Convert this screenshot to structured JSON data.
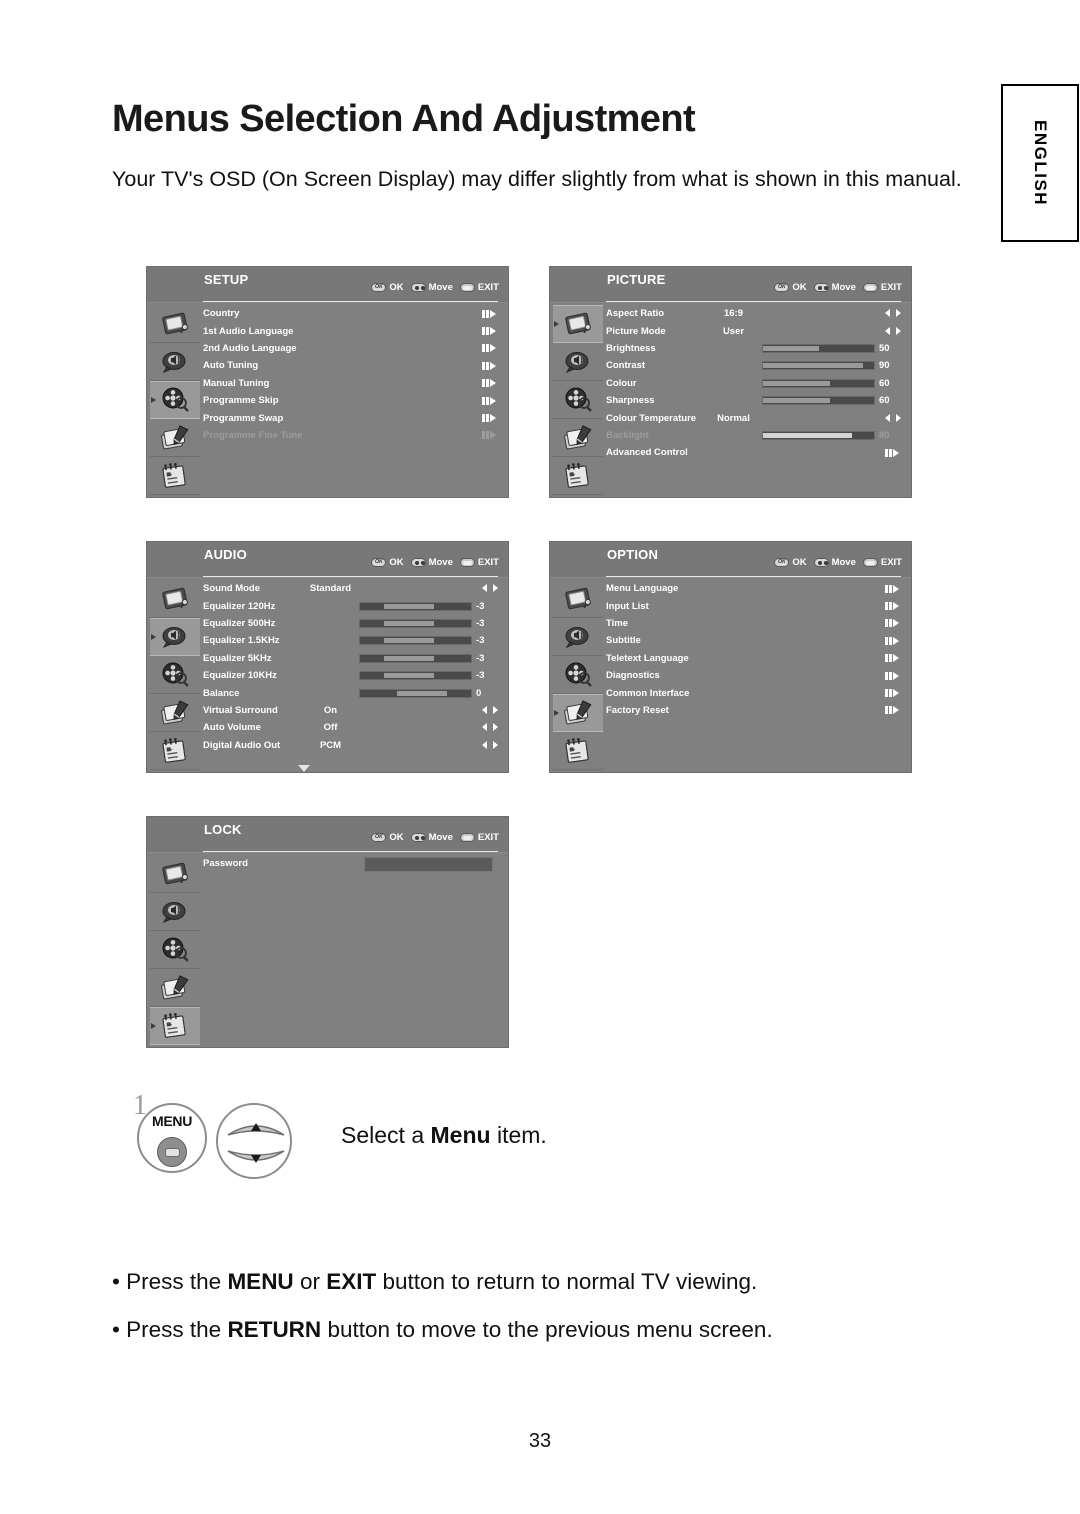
{
  "page": {
    "title": "Menus Selection And Adjustment",
    "intro": "Your TV's OSD (On Screen Display) may differ slightly from what is shown in this manual.",
    "language_tab": "ENGLISH",
    "page_number": "33",
    "step_number": "1",
    "step_text_pre": "Select a ",
    "step_text_bold": "Menu",
    "step_text_post": " item.",
    "menu_button_label": "MENU"
  },
  "hints": {
    "ok": "OK",
    "move": "Move",
    "exit": "EXIT"
  },
  "colors": {
    "panel_bg": "#808080",
    "header_bg": "#787878",
    "text": "#ffffff",
    "disabled_text": "#9c9c9c",
    "slider_track": "#4a4a4a",
    "slider_fill": "#9a9a9a",
    "highlight": "#999999"
  },
  "menus": [
    {
      "id": "setup",
      "title": "SETUP",
      "active_icon": 2,
      "icons": [
        "picture-icon",
        "audio-icon",
        "setup-icon",
        "option-icon",
        "lock-icon"
      ],
      "items": [
        {
          "label": "Country",
          "type": "submenu",
          "disabled": false
        },
        {
          "label": "1st Audio Language",
          "type": "submenu",
          "disabled": false
        },
        {
          "label": "2nd Audio Language",
          "type": "submenu",
          "disabled": false
        },
        {
          "label": "Auto Tuning",
          "type": "submenu",
          "disabled": false
        },
        {
          "label": "Manual Tuning",
          "type": "submenu",
          "disabled": false
        },
        {
          "label": "Programme Skip",
          "type": "submenu",
          "disabled": false
        },
        {
          "label": "Programme Swap",
          "type": "submenu",
          "disabled": false
        },
        {
          "label": "Programme Fine Tune",
          "type": "submenu",
          "disabled": true
        }
      ]
    },
    {
      "id": "picture",
      "title": "PICTURE",
      "active_icon": 0,
      "icons": [
        "picture-icon",
        "audio-icon",
        "setup-icon",
        "option-icon",
        "lock-icon"
      ],
      "items": [
        {
          "label": "Aspect Ratio",
          "type": "value",
          "value": "16:9",
          "disabled": false
        },
        {
          "label": "Picture Mode",
          "type": "value",
          "value": "User",
          "disabled": false
        },
        {
          "label": "Brightness",
          "type": "slider",
          "num": "50",
          "percent": 50,
          "disabled": false
        },
        {
          "label": "Contrast",
          "type": "slider",
          "num": "90",
          "percent": 90,
          "disabled": false
        },
        {
          "label": "Colour",
          "type": "slider",
          "num": "60",
          "percent": 60,
          "disabled": false
        },
        {
          "label": "Sharpness",
          "type": "slider",
          "num": "60",
          "percent": 60,
          "disabled": false
        },
        {
          "label": "Colour Temperature",
          "type": "value",
          "value": "Normal",
          "disabled": false
        },
        {
          "label": "Backlight",
          "type": "slider",
          "num": "80",
          "percent": 80,
          "disabled": true
        },
        {
          "label": "Advanced Control",
          "type": "submenu",
          "disabled": false
        }
      ]
    },
    {
      "id": "audio",
      "title": "AUDIO",
      "active_icon": 1,
      "icons": [
        "picture-icon",
        "audio-icon",
        "setup-icon",
        "option-icon",
        "lock-icon"
      ],
      "has_more": true,
      "items": [
        {
          "label": "Sound Mode",
          "type": "value",
          "value": "Standard",
          "disabled": false
        },
        {
          "label": "Equalizer 120Hz",
          "type": "slider",
          "num": "-3",
          "start": 22,
          "percent": 45,
          "disabled": false
        },
        {
          "label": "Equalizer 500Hz",
          "type": "slider",
          "num": "-3",
          "start": 22,
          "percent": 45,
          "disabled": false
        },
        {
          "label": "Equalizer 1.5KHz",
          "type": "slider",
          "num": "-3",
          "start": 22,
          "percent": 45,
          "disabled": false
        },
        {
          "label": "Equalizer 5KHz",
          "type": "slider",
          "num": "-3",
          "start": 22,
          "percent": 45,
          "disabled": false
        },
        {
          "label": "Equalizer 10KHz",
          "type": "slider",
          "num": "-3",
          "start": 22,
          "percent": 45,
          "disabled": false
        },
        {
          "label": "Balance",
          "type": "slider",
          "num": "0",
          "start": 33,
          "percent": 45,
          "disabled": false
        },
        {
          "label": "Virtual Surround",
          "type": "value",
          "value": "On",
          "disabled": false
        },
        {
          "label": "Auto Volume",
          "type": "value",
          "value": "Off",
          "disabled": false
        },
        {
          "label": "Digital Audio Out",
          "type": "value",
          "value": "PCM",
          "disabled": false
        }
      ]
    },
    {
      "id": "option",
      "title": "OPTION",
      "active_icon": 3,
      "icons": [
        "picture-icon",
        "audio-icon",
        "setup-icon",
        "option-icon",
        "lock-icon"
      ],
      "items": [
        {
          "label": "Menu Language",
          "type": "submenu",
          "disabled": false
        },
        {
          "label": "Input List",
          "type": "submenu",
          "disabled": false
        },
        {
          "label": "Time",
          "type": "submenu",
          "disabled": false
        },
        {
          "label": "Subtitle",
          "type": "submenu",
          "disabled": false
        },
        {
          "label": "Teletext Language",
          "type": "submenu",
          "disabled": false
        },
        {
          "label": "Diagnostics",
          "type": "submenu",
          "disabled": false
        },
        {
          "label": "Common Interface",
          "type": "submenu",
          "disabled": false
        },
        {
          "label": "Factory Reset",
          "type": "submenu",
          "disabled": false
        }
      ]
    },
    {
      "id": "lock",
      "title": "LOCK",
      "active_icon": 4,
      "icons": [
        "picture-icon",
        "audio-icon",
        "setup-icon",
        "option-icon",
        "lock-icon"
      ],
      "items": [
        {
          "label": "Password",
          "type": "field",
          "value": "",
          "disabled": false
        }
      ]
    }
  ],
  "bullets": [
    {
      "pre": "• Press the ",
      "b1": "MENU",
      "mid": " or ",
      "b2": "EXIT",
      "post": " button to return to normal TV viewing."
    },
    {
      "pre": "• Press the ",
      "b1": "RETURN",
      "mid": "",
      "b2": "",
      "post": " button to move to the previous menu screen."
    }
  ]
}
